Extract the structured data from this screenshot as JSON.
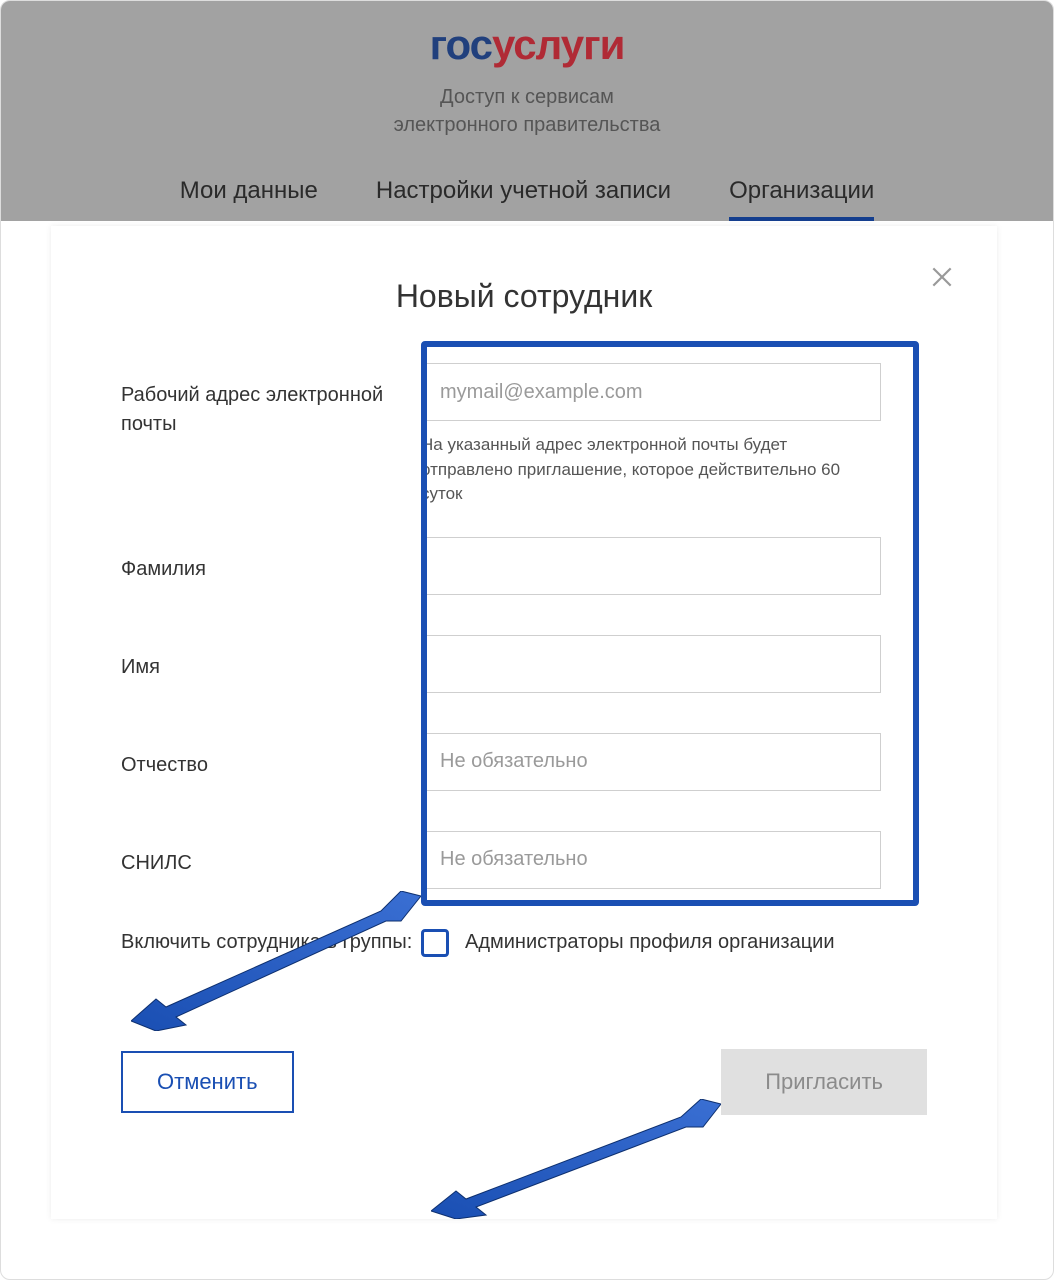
{
  "header": {
    "logo_part1": "гос",
    "logo_part2": "услуги",
    "subtitle_line1": "Доступ к сервисам",
    "subtitle_line2": "электронного правительства"
  },
  "tabs": {
    "my_data": "Мои данные",
    "account_settings": "Настройки учетной записи",
    "organizations": "Организации"
  },
  "modal": {
    "title": "Новый сотрудник",
    "email_label": "Рабочий адрес электронной почты",
    "email_placeholder": "mymail@example.com",
    "email_hint": "На указанный адрес электронной почты будет отправлено приглашение, которое действительно 60 суток",
    "lastname_label": "Фамилия",
    "firstname_label": "Имя",
    "middlename_label": "Отчество",
    "middlename_placeholder": "Не обязательно",
    "snils_label": "СНИЛС",
    "snils_placeholder": "Не обязательно",
    "groups_label": "Включить сотрудника в группы:",
    "group_admin_label": "Администраторы профиля организации",
    "cancel_button": "Отменить",
    "invite_button": "Пригласить"
  }
}
